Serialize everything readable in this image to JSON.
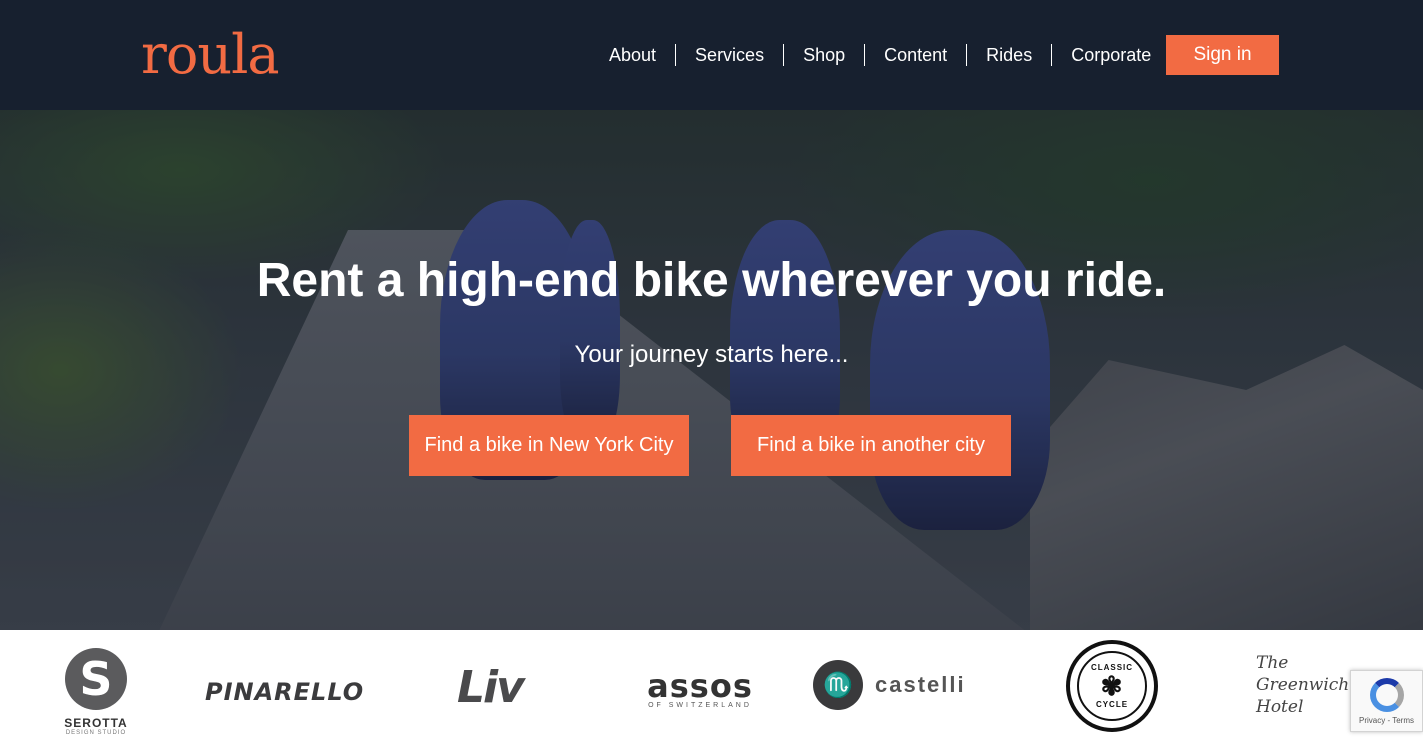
{
  "header": {
    "logo": "roula",
    "nav": [
      "About",
      "Services",
      "Shop",
      "Content",
      "Rides",
      "Corporate"
    ],
    "signin_label": "Sign in"
  },
  "hero": {
    "title": "Rent a high-end bike wherever you ride.",
    "subtitle": "Your journey starts here...",
    "cta_nyc": "Find a bike in New York City",
    "cta_other": "Find a bike in another city"
  },
  "brands": {
    "serotta": "SEROTTA",
    "serotta_sub": "DESIGN STUDIO",
    "pinarello": "PINARELLO",
    "liv": "Liv",
    "assos": "assos",
    "assos_sub": "OF SWITZERLAND",
    "castelli": "castelli",
    "classic_cycle_top": "CLASSIC",
    "classic_cycle_bottom": "CYCLE",
    "greenwich": "The Greenwich Hotel"
  },
  "recaptcha": {
    "label": "Privacy - Terms"
  },
  "colors": {
    "header_bg": "#17202f",
    "accent": "#f26b43"
  },
  "icons": {
    "recaptcha": "recaptcha-icon"
  }
}
